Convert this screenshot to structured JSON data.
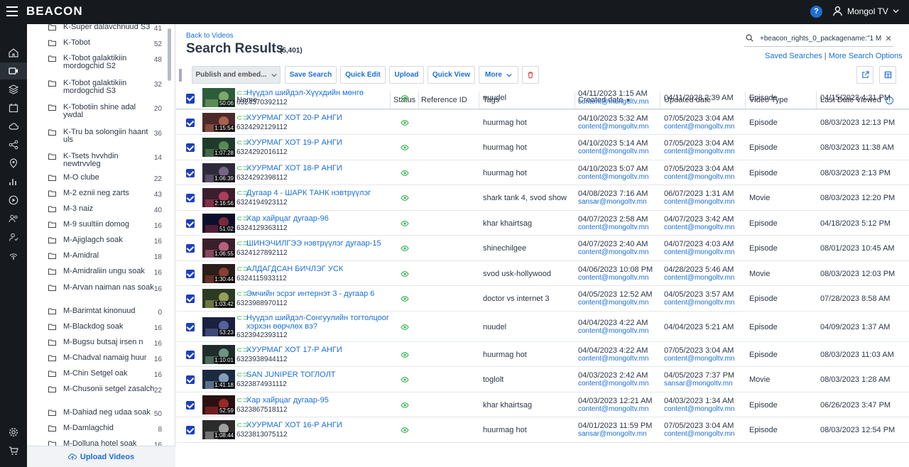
{
  "app": {
    "logo": "BEACON",
    "help": "?",
    "user": "Mongol TV"
  },
  "folders": [
    {
      "name": "K-Super dalavchnuud S3",
      "count": "41"
    },
    {
      "name": "K-Tobot",
      "count": "52"
    },
    {
      "name": "K-Tobot galaktikiin mordogchid S2",
      "count": "48"
    },
    {
      "name": "K-Tobot galaktikiin mordogchid S3",
      "count": "32"
    },
    {
      "name": "K-Tobotiin shine adal ywdal",
      "count": "20"
    },
    {
      "name": "K-Tru ba solongiin haant uls",
      "count": "36"
    },
    {
      "name": "K-Tsets hvvhdin newtrvvleg",
      "count": "14"
    },
    {
      "name": "M-O clube",
      "count": "22"
    },
    {
      "name": "M-2 eznii neg zarts",
      "count": "43"
    },
    {
      "name": "M-3 naiz",
      "count": "40"
    },
    {
      "name": "M-9 suultiin domog",
      "count": "16"
    },
    {
      "name": "M-Ajiglagch soak",
      "count": "16"
    },
    {
      "name": "M-Amidral",
      "count": "18"
    },
    {
      "name": "M-Amidraliin ungu soak",
      "count": "16"
    },
    {
      "name": "M-Arvan naiman nas soak",
      "count": "16"
    },
    {
      "name": "M-Barimtat kinonuud",
      "count": "0"
    },
    {
      "name": "M-Blackdog soak",
      "count": "16"
    },
    {
      "name": "M-Bugsu butsaj irsen n",
      "count": "16"
    },
    {
      "name": "M-Chadval namaig huur",
      "count": "16"
    },
    {
      "name": "M-Chin Setgel oak",
      "count": "16"
    },
    {
      "name": "M-Chusonii setgel zasalch",
      "count": "22"
    },
    {
      "name": "M-Dahiad neg udaa soak",
      "count": "50"
    },
    {
      "name": "M-Damlagchid",
      "count": "8"
    },
    {
      "name": "M-Dolluna hotel soak",
      "count": "16"
    }
  ],
  "upload_videos": "Upload Videos",
  "back_link": "Back to Videos",
  "page_title": "Search Results",
  "result_count": "(5,401)",
  "search_query": "+beacon_rights_0_packagename:\"1 M",
  "saved_searches": "Saved Searches",
  "more_search_options": "More Search Options",
  "toolbar": {
    "publish": "Publish and embed...",
    "save_search": "Save Search",
    "quick_edit": "Quick Edit",
    "upload": "Upload",
    "quick_view": "Quick View",
    "more": "More"
  },
  "columns": {
    "name": "Name",
    "status": "Status",
    "reference_id": "Reference ID",
    "tags": "Tags",
    "created": "Created date",
    "updated": "Updated date",
    "video_type": "Video Type",
    "last_viewed": "Last Date Viewed"
  },
  "rows": [
    {
      "duration": "50:06",
      "name": "Нүүдэл шийдэл-Хүүхдийн мөнгө",
      "id": "6324370392112",
      "tags": "nuudel",
      "created": "04/11/2023 1:15 AM",
      "created_by": "content@mongoltv.mn",
      "updated": "04/11/2023 2:39 AM",
      "updated_by": "",
      "type": "Episode",
      "last_viewed": "04/15/2023 4:31 PM"
    },
    {
      "duration": "1:15:54",
      "name": "ХУУРМАГ ХОТ 20-Р АНГИ",
      "id": "6324292129112",
      "tags": "huurmag hot",
      "created": "04/10/2023 5:32 AM",
      "created_by": "content@mongoltv.mn",
      "updated": "07/05/2023 3:04 AM",
      "updated_by": "content@mongoltv.mn",
      "type": "Episode",
      "last_viewed": "08/03/2023 12:13 PM"
    },
    {
      "duration": "1:07:28",
      "name": "ХУУРМАГ ХОТ 19-Р АНГИ",
      "id": "6324292016112",
      "tags": "huurmag hot",
      "created": "04/10/2023 5:14 AM",
      "created_by": "content@mongoltv.mn",
      "updated": "07/05/2023 3:04 AM",
      "updated_by": "content@mongoltv.mn",
      "type": "Episode",
      "last_viewed": "08/03/2023 11:38 AM"
    },
    {
      "duration": "1:06:39",
      "name": "ХУУРМАГ ХОТ 18-Р АНГИ",
      "id": "6324292398112",
      "tags": "huurmag hot",
      "created": "04/10/2023 5:07 AM",
      "created_by": "content@mongoltv.mn",
      "updated": "07/05/2023 3:04 AM",
      "updated_by": "content@mongoltv.mn",
      "type": "Episode",
      "last_viewed": "08/03/2023 2:13 PM"
    },
    {
      "duration": "2:16:56",
      "name": "Дугаар 4 - ШАРК ТАНК нэвтрүүлэг",
      "id": "6324194923112",
      "tags": "shark tank 4, svod show",
      "created": "04/08/2023 7:16 AM",
      "created_by": "sansar@mongoltv.mn",
      "updated": "06/07/2023 1:31 AM",
      "updated_by": "content@mongoltv.mn",
      "type": "Movie",
      "last_viewed": "08/03/2023 12:20 PM"
    },
    {
      "duration": "51:02",
      "name": "Хар хайрцаг дугаар-96",
      "id": "6324129363112",
      "tags": "khar khairtsag",
      "created": "04/07/2023 2:58 AM",
      "created_by": "content@mongoltv.mn",
      "updated": "04/07/2023 3:42 AM",
      "updated_by": "content@mongoltv.mn",
      "type": "Episode",
      "last_viewed": "04/18/2023 5:12 PM"
    },
    {
      "duration": "1:06:55",
      "name": "ШИНЭЧИЛГЭЭ нэвтрүүлэг дугаар-15",
      "id": "6324127892112",
      "tags": "shinechilgee",
      "created": "04/07/2023 2:40 AM",
      "created_by": "content@mongoltv.mn",
      "updated": "04/07/2023 4:03 AM",
      "updated_by": "content@mongoltv.mn",
      "type": "Episode",
      "last_viewed": "08/01/2023 10:45 AM"
    },
    {
      "duration": "1:30:44",
      "name": "АЛДАГДСАН БИЧЛЭГ УСК",
      "id": "6324115933112",
      "tags": "svod usk-hollywood",
      "created": "04/06/2023 10:08 PM",
      "created_by": "content@mongoltv.mn",
      "updated": "04/28/2023 5:46 AM",
      "updated_by": "content@mongoltv.mn",
      "type": "Movie",
      "last_viewed": "08/03/2023 12:03 PM"
    },
    {
      "duration": "1:03:42",
      "name": "Эмчийн эсрэг интернэт 3 - дугаар 6",
      "id": "6323988970112",
      "tags": "doctor vs internet 3",
      "created": "04/05/2023 12:52 AM",
      "created_by": "content@mongoltv.mn",
      "updated": "04/05/2023 3:57 AM",
      "updated_by": "content@mongoltv.mn",
      "type": "Episode",
      "last_viewed": "07/28/2023 8:58 AM"
    },
    {
      "duration": "53:23",
      "name": "Нүүдэл шийдэл-Сонгуулийн тогтолцоог",
      "name2": "хэрхэн өөрчлөх вэ?",
      "id": "6323942393112",
      "tags": "nuudel",
      "created": "04/04/2023 4:22 AM",
      "created_by": "content@mongoltv.mn",
      "updated": "04/04/2023 5:21 AM",
      "updated_by": "",
      "type": "Episode",
      "last_viewed": "04/09/2023 1:37 AM"
    },
    {
      "duration": "1:10:01",
      "name": "ХУУРМАГ ХОТ 17-Р АНГИ",
      "id": "6323938944112",
      "tags": "huurmag hot",
      "created": "04/04/2023 4:22 AM",
      "created_by": "content@mongoltv.mn",
      "updated": "07/05/2023 3:04 AM",
      "updated_by": "content@mongoltv.mn",
      "type": "Episode",
      "last_viewed": "08/03/2023 11:03 AM"
    },
    {
      "duration": "1:41:18",
      "name": "SAN JUNIPER ТОГЛОЛТ",
      "id": "6323874931112",
      "tags": "toglolt",
      "created": "04/03/2023 2:42 AM",
      "created_by": "content@mongoltv.mn",
      "updated": "04/05/2023 7:37 PM",
      "updated_by": "sansar@mongoltv.mn",
      "type": "Movie",
      "last_viewed": "08/03/2023 1:28 AM"
    },
    {
      "duration": "52:59",
      "name": "Хар хайрцаг дугаар-95",
      "id": "6323867518112",
      "tags": "khar khairtsag",
      "created": "04/03/2023 12:21 AM",
      "created_by": "content@mongoltv.mn",
      "updated": "04/03/2023 1:34 AM",
      "updated_by": "content@mongoltv.mn",
      "type": "Episode",
      "last_viewed": "06/26/2023 3:47 PM"
    },
    {
      "duration": "1:08:44",
      "name": "ХУУРМАГ ХОТ 16-Р АНГИ",
      "id": "6323813075112",
      "tags": "huurmag hot",
      "created": "04/01/2023 11:59 PM",
      "created_by": "sansar@mongoltv.mn",
      "updated": "07/05/2023 3:04 AM",
      "updated_by": "content@mongoltv.mn",
      "type": "Episode",
      "last_viewed": "08/03/2023 12:54 PM"
    }
  ]
}
